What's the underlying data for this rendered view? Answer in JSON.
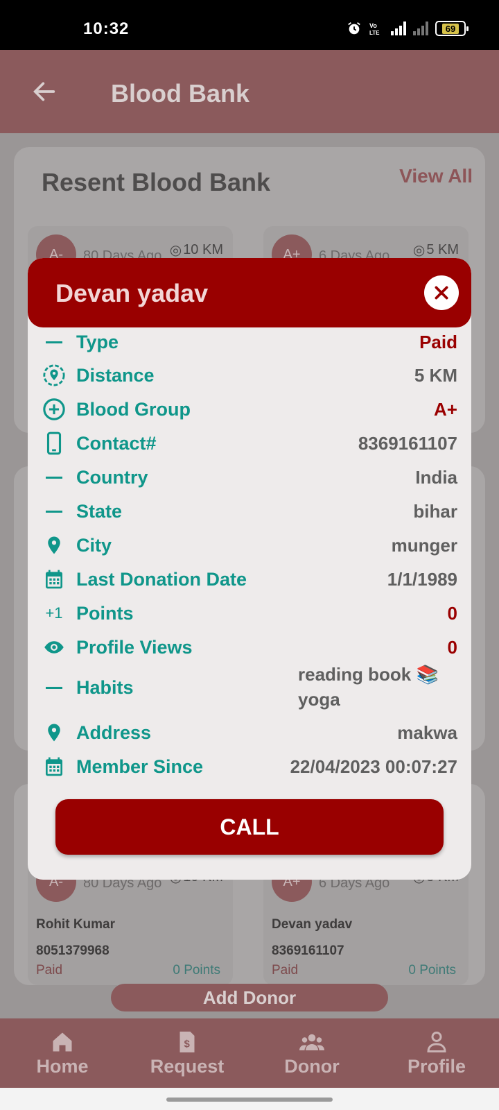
{
  "status_bar": {
    "time": "10:32",
    "battery": "69"
  },
  "app_bar": {
    "title": "Blood Bank"
  },
  "recent": {
    "title": "Resent Blood Bank",
    "view_all": "View All"
  },
  "cards": [
    {
      "group": "A-",
      "ago": "80 Days Ago",
      "km": "10 KM",
      "name": "",
      "phone": "",
      "paid": "",
      "points": ""
    },
    {
      "group": "A+",
      "ago": "6 Days Ago",
      "km": "5 KM",
      "name": "",
      "phone": "",
      "paid": "",
      "points": ""
    },
    {
      "group": "A-",
      "ago": "80 Days Ago",
      "km": "10 KM",
      "name": "Rohit Kumar",
      "phone": "8051379968",
      "paid": "Paid",
      "points": "0 Points"
    },
    {
      "group": "A+",
      "ago": "6 Days Ago",
      "km": "5 KM",
      "name": "Devan yadav",
      "phone": "8369161107",
      "paid": "Paid",
      "points": "0 Points"
    }
  ],
  "add_donor": "Add Donor",
  "nav": {
    "home": "Home",
    "request": "Request",
    "donor": "Donor",
    "profile": "Profile"
  },
  "dialog": {
    "name": "Devan yadav",
    "rows": {
      "type": {
        "label": "Type",
        "value": "Paid"
      },
      "distance": {
        "label": "Distance",
        "value": "5 KM"
      },
      "blood_group": {
        "label": "Blood Group",
        "value": "A+"
      },
      "contact": {
        "label": "Contact#",
        "value": "8369161107"
      },
      "country": {
        "label": "Country",
        "value": "India"
      },
      "state": {
        "label": "State",
        "value": "bihar"
      },
      "city": {
        "label": "City",
        "value": "munger"
      },
      "last_donation": {
        "label": "Last Donation Date",
        "value": "1/1/1989"
      },
      "points": {
        "label": "Points",
        "value": "0",
        "icon_text": "+1"
      },
      "profile_views": {
        "label": "Profile Views",
        "value": "0"
      },
      "habits": {
        "label": "Habits",
        "value_line1": "reading book 📚",
        "value_line2": "yoga"
      },
      "address": {
        "label": "Address",
        "value": "makwa"
      },
      "member_since": {
        "label": "Member Since",
        "value": "22/04/2023 00:07:27"
      }
    },
    "call": "CALL"
  }
}
